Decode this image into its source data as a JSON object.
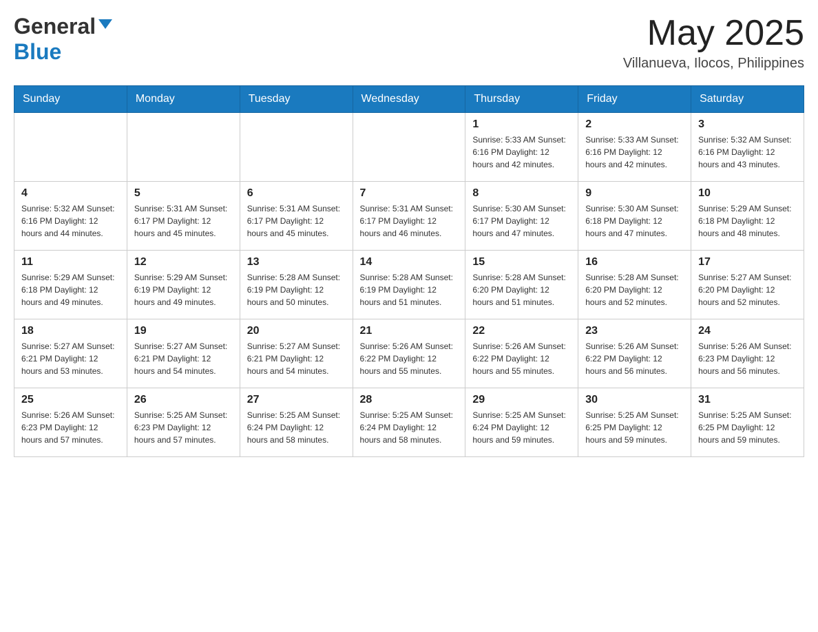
{
  "header": {
    "logo": {
      "general": "General",
      "blue": "Blue"
    },
    "month": "May 2025",
    "location": "Villanueva, Ilocos, Philippines"
  },
  "weekdays": [
    "Sunday",
    "Monday",
    "Tuesday",
    "Wednesday",
    "Thursday",
    "Friday",
    "Saturday"
  ],
  "weeks": [
    [
      {
        "day": "",
        "info": ""
      },
      {
        "day": "",
        "info": ""
      },
      {
        "day": "",
        "info": ""
      },
      {
        "day": "",
        "info": ""
      },
      {
        "day": "1",
        "info": "Sunrise: 5:33 AM\nSunset: 6:16 PM\nDaylight: 12 hours and 42 minutes."
      },
      {
        "day": "2",
        "info": "Sunrise: 5:33 AM\nSunset: 6:16 PM\nDaylight: 12 hours and 42 minutes."
      },
      {
        "day": "3",
        "info": "Sunrise: 5:32 AM\nSunset: 6:16 PM\nDaylight: 12 hours and 43 minutes."
      }
    ],
    [
      {
        "day": "4",
        "info": "Sunrise: 5:32 AM\nSunset: 6:16 PM\nDaylight: 12 hours and 44 minutes."
      },
      {
        "day": "5",
        "info": "Sunrise: 5:31 AM\nSunset: 6:17 PM\nDaylight: 12 hours and 45 minutes."
      },
      {
        "day": "6",
        "info": "Sunrise: 5:31 AM\nSunset: 6:17 PM\nDaylight: 12 hours and 45 minutes."
      },
      {
        "day": "7",
        "info": "Sunrise: 5:31 AM\nSunset: 6:17 PM\nDaylight: 12 hours and 46 minutes."
      },
      {
        "day": "8",
        "info": "Sunrise: 5:30 AM\nSunset: 6:17 PM\nDaylight: 12 hours and 47 minutes."
      },
      {
        "day": "9",
        "info": "Sunrise: 5:30 AM\nSunset: 6:18 PM\nDaylight: 12 hours and 47 minutes."
      },
      {
        "day": "10",
        "info": "Sunrise: 5:29 AM\nSunset: 6:18 PM\nDaylight: 12 hours and 48 minutes."
      }
    ],
    [
      {
        "day": "11",
        "info": "Sunrise: 5:29 AM\nSunset: 6:18 PM\nDaylight: 12 hours and 49 minutes."
      },
      {
        "day": "12",
        "info": "Sunrise: 5:29 AM\nSunset: 6:19 PM\nDaylight: 12 hours and 49 minutes."
      },
      {
        "day": "13",
        "info": "Sunrise: 5:28 AM\nSunset: 6:19 PM\nDaylight: 12 hours and 50 minutes."
      },
      {
        "day": "14",
        "info": "Sunrise: 5:28 AM\nSunset: 6:19 PM\nDaylight: 12 hours and 51 minutes."
      },
      {
        "day": "15",
        "info": "Sunrise: 5:28 AM\nSunset: 6:20 PM\nDaylight: 12 hours and 51 minutes."
      },
      {
        "day": "16",
        "info": "Sunrise: 5:28 AM\nSunset: 6:20 PM\nDaylight: 12 hours and 52 minutes."
      },
      {
        "day": "17",
        "info": "Sunrise: 5:27 AM\nSunset: 6:20 PM\nDaylight: 12 hours and 52 minutes."
      }
    ],
    [
      {
        "day": "18",
        "info": "Sunrise: 5:27 AM\nSunset: 6:21 PM\nDaylight: 12 hours and 53 minutes."
      },
      {
        "day": "19",
        "info": "Sunrise: 5:27 AM\nSunset: 6:21 PM\nDaylight: 12 hours and 54 minutes."
      },
      {
        "day": "20",
        "info": "Sunrise: 5:27 AM\nSunset: 6:21 PM\nDaylight: 12 hours and 54 minutes."
      },
      {
        "day": "21",
        "info": "Sunrise: 5:26 AM\nSunset: 6:22 PM\nDaylight: 12 hours and 55 minutes."
      },
      {
        "day": "22",
        "info": "Sunrise: 5:26 AM\nSunset: 6:22 PM\nDaylight: 12 hours and 55 minutes."
      },
      {
        "day": "23",
        "info": "Sunrise: 5:26 AM\nSunset: 6:22 PM\nDaylight: 12 hours and 56 minutes."
      },
      {
        "day": "24",
        "info": "Sunrise: 5:26 AM\nSunset: 6:23 PM\nDaylight: 12 hours and 56 minutes."
      }
    ],
    [
      {
        "day": "25",
        "info": "Sunrise: 5:26 AM\nSunset: 6:23 PM\nDaylight: 12 hours and 57 minutes."
      },
      {
        "day": "26",
        "info": "Sunrise: 5:25 AM\nSunset: 6:23 PM\nDaylight: 12 hours and 57 minutes."
      },
      {
        "day": "27",
        "info": "Sunrise: 5:25 AM\nSunset: 6:24 PM\nDaylight: 12 hours and 58 minutes."
      },
      {
        "day": "28",
        "info": "Sunrise: 5:25 AM\nSunset: 6:24 PM\nDaylight: 12 hours and 58 minutes."
      },
      {
        "day": "29",
        "info": "Sunrise: 5:25 AM\nSunset: 6:24 PM\nDaylight: 12 hours and 59 minutes."
      },
      {
        "day": "30",
        "info": "Sunrise: 5:25 AM\nSunset: 6:25 PM\nDaylight: 12 hours and 59 minutes."
      },
      {
        "day": "31",
        "info": "Sunrise: 5:25 AM\nSunset: 6:25 PM\nDaylight: 12 hours and 59 minutes."
      }
    ]
  ]
}
